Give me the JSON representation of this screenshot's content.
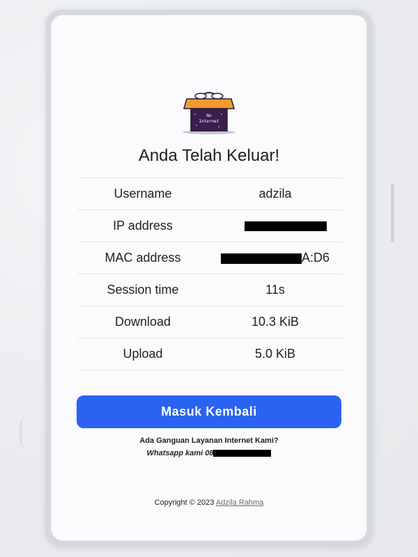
{
  "page": {
    "title": "Anda Telah Keluar!",
    "logo_icon": "no-internet-box-icon",
    "logo_text_line1": "No",
    "logo_text_line2": "Internet"
  },
  "info_rows": [
    {
      "label": "Username",
      "value": "adzila"
    },
    {
      "label": "IP address",
      "value": ""
    },
    {
      "label": "MAC address",
      "value": "A:D6"
    },
    {
      "label": "Session time",
      "value": "11s"
    },
    {
      "label": "Download",
      "value": "10.3 KiB"
    },
    {
      "label": "Upload",
      "value": "5.0 KiB"
    }
  ],
  "actions": {
    "login_again_label": "Masuk Kembali"
  },
  "help": {
    "question": "Ada Ganguan Layanan Internet Kami?",
    "whatsapp_prefix": "Whatsapp kami 08"
  },
  "footer": {
    "copyright_prefix": "Copyright © 2023",
    "author_link": "Adzila Rahma"
  },
  "colors": {
    "accent": "#2a63f0",
    "logo_orange": "#f29a2e",
    "logo_purple": "#3b1d4f"
  }
}
